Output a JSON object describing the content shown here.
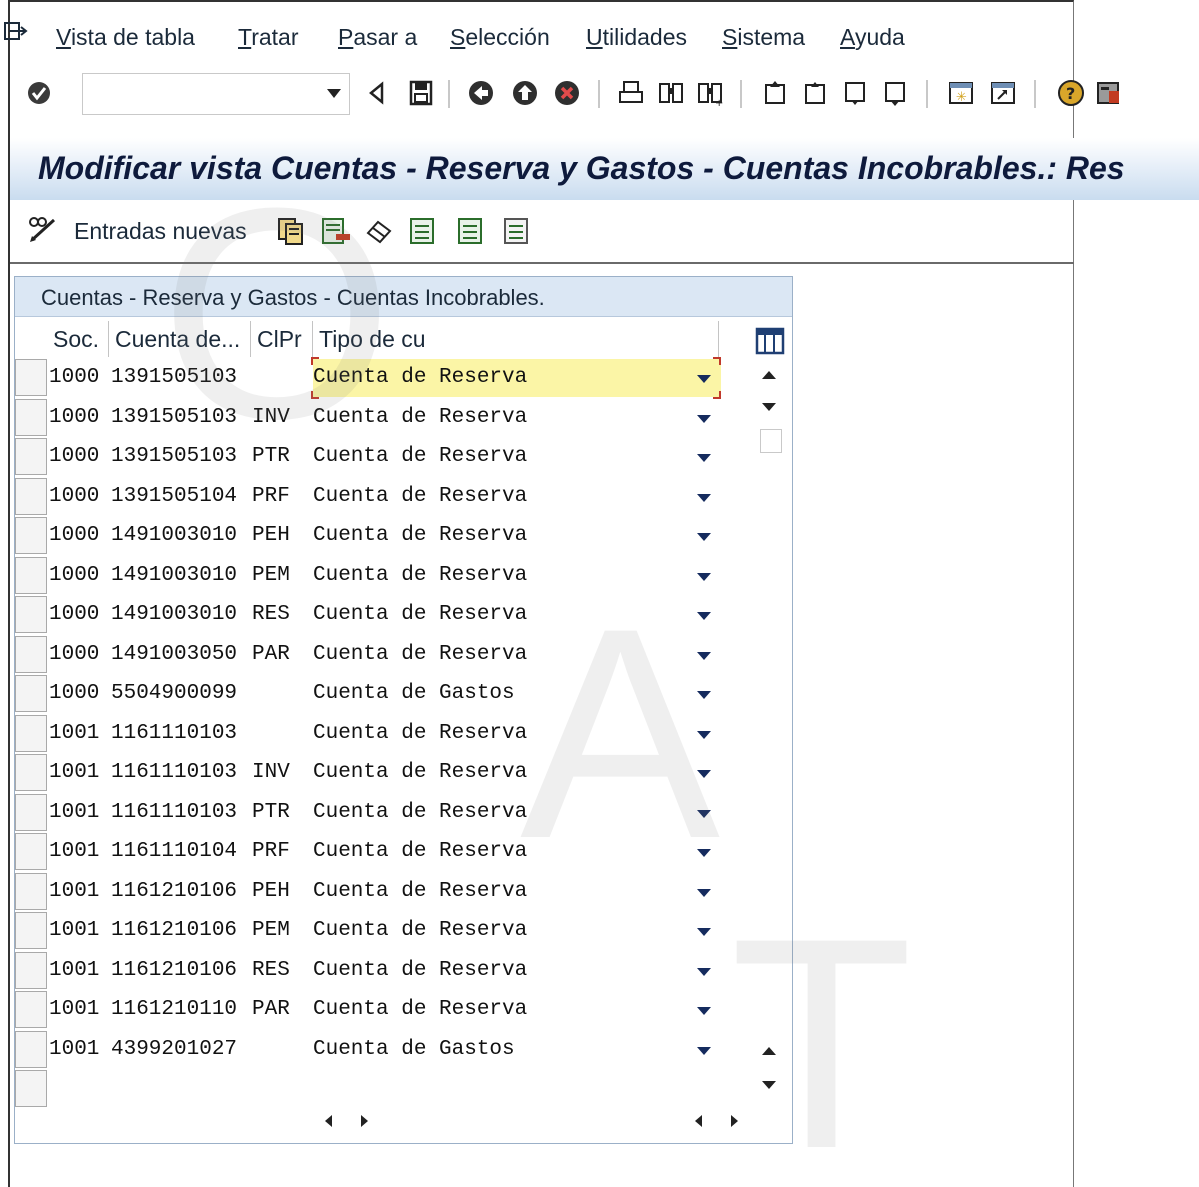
{
  "menu": {
    "items": [
      {
        "label": "Vista de tabla",
        "underline": "V",
        "rest": "ista de tabla"
      },
      {
        "label": "Tratar",
        "underline": "T",
        "rest": "ratar"
      },
      {
        "label": "Pasar a",
        "underline": "P",
        "rest": "asar a"
      },
      {
        "label": "Selección",
        "underline": "S",
        "rest": "elección"
      },
      {
        "label": "Utilidades",
        "underline": "U",
        "rest": "tilidades"
      },
      {
        "label": "Sistema",
        "underline": "S",
        "rest": "istema"
      },
      {
        "label": "Ayuda",
        "underline": "A",
        "rest": "yuda"
      }
    ]
  },
  "toolbar": {
    "command_value": ""
  },
  "title": "Modificar vista Cuentas - Reserva y Gastos - Cuentas Incobrables.: Res",
  "app_toolbar": {
    "new_entries_label": "Entradas nuevas"
  },
  "table": {
    "title": "Cuentas - Reserva y Gastos - Cuentas Incobrables.",
    "columns": [
      "Soc.",
      "Cuenta de...",
      "ClPr",
      "Tipo de cu"
    ],
    "rows": [
      {
        "soc": "1000",
        "cuenta": "1391505103",
        "clpr": "",
        "tipo": "Cuenta de Reserva"
      },
      {
        "soc": "1000",
        "cuenta": "1391505103",
        "clpr": "INV",
        "tipo": "Cuenta de Reserva"
      },
      {
        "soc": "1000",
        "cuenta": "1391505103",
        "clpr": "PTR",
        "tipo": "Cuenta de Reserva"
      },
      {
        "soc": "1000",
        "cuenta": "1391505104",
        "clpr": "PRF",
        "tipo": "Cuenta de Reserva"
      },
      {
        "soc": "1000",
        "cuenta": "1491003010",
        "clpr": "PEH",
        "tipo": "Cuenta de Reserva"
      },
      {
        "soc": "1000",
        "cuenta": "1491003010",
        "clpr": "PEM",
        "tipo": "Cuenta de Reserva"
      },
      {
        "soc": "1000",
        "cuenta": "1491003010",
        "clpr": "RES",
        "tipo": "Cuenta de Reserva"
      },
      {
        "soc": "1000",
        "cuenta": "1491003050",
        "clpr": "PAR",
        "tipo": "Cuenta de Reserva"
      },
      {
        "soc": "1000",
        "cuenta": "5504900099",
        "clpr": "",
        "tipo": "Cuenta de Gastos"
      },
      {
        "soc": "1001",
        "cuenta": "1161110103",
        "clpr": "",
        "tipo": "Cuenta de Reserva"
      },
      {
        "soc": "1001",
        "cuenta": "1161110103",
        "clpr": "INV",
        "tipo": "Cuenta de Reserva"
      },
      {
        "soc": "1001",
        "cuenta": "1161110103",
        "clpr": "PTR",
        "tipo": "Cuenta de Reserva"
      },
      {
        "soc": "1001",
        "cuenta": "1161110104",
        "clpr": "PRF",
        "tipo": "Cuenta de Reserva"
      },
      {
        "soc": "1001",
        "cuenta": "1161210106",
        "clpr": "PEH",
        "tipo": "Cuenta de Reserva"
      },
      {
        "soc": "1001",
        "cuenta": "1161210106",
        "clpr": "PEM",
        "tipo": "Cuenta de Reserva"
      },
      {
        "soc": "1001",
        "cuenta": "1161210106",
        "clpr": "RES",
        "tipo": "Cuenta de Reserva"
      },
      {
        "soc": "1001",
        "cuenta": "1161210110",
        "clpr": "PAR",
        "tipo": "Cuenta de Reserva"
      },
      {
        "soc": "1001",
        "cuenta": "4399201027",
        "clpr": "",
        "tipo": "Cuenta de Gastos"
      }
    ],
    "selected_row": 0
  },
  "colors": {
    "title_gradient_end": "#c9dcef",
    "panel_header": "#dbe7f4",
    "highlight": "#fbf5a6",
    "focus_corner": "#c0392b",
    "dropdown_arrow": "#152b5e"
  }
}
